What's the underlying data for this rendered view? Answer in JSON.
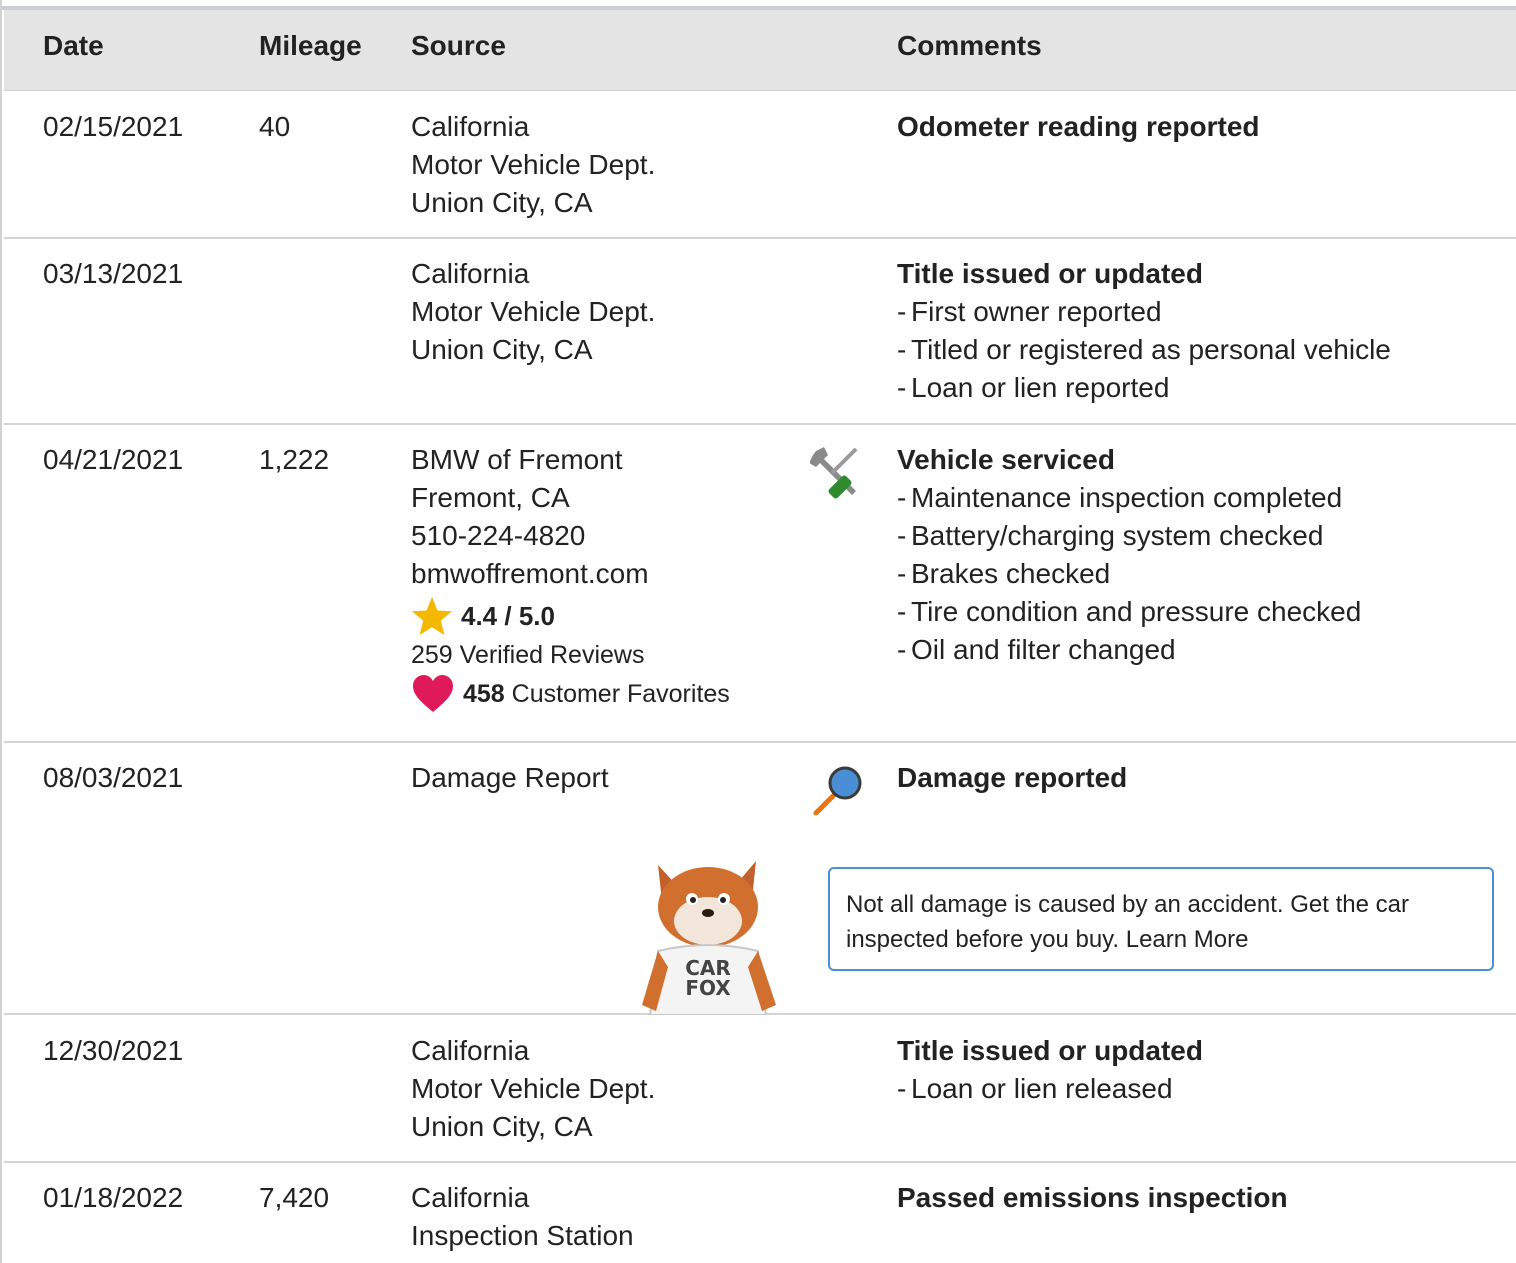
{
  "header": {
    "date": "Date",
    "mileage": "Mileage",
    "source": "Source",
    "comments": "Comments"
  },
  "rows": [
    {
      "date": "02/15/2021",
      "mileage": "40",
      "source": [
        "California",
        "Motor Vehicle Dept.",
        "Union City, CA"
      ],
      "title": "Odometer reading reported",
      "details": []
    },
    {
      "date": "03/13/2021",
      "mileage": "",
      "source": [
        "California",
        "Motor Vehicle Dept.",
        "Union City, CA"
      ],
      "title": "Title issued or updated",
      "details": [
        "First owner reported",
        "Titled or registered as personal vehicle",
        "Loan or lien reported"
      ]
    },
    {
      "date": "04/21/2021",
      "mileage": "1,222",
      "source": [
        "BMW of Fremont",
        "Fremont, CA",
        "510-224-4820",
        "bmwoffremont.com"
      ],
      "rating": "4.4 / 5.0",
      "reviews": "259 Verified Reviews",
      "favorites_count": "458",
      "favorites_label": "Customer Favorites",
      "icon": "wrench-screwdriver-icon",
      "title": "Vehicle serviced",
      "details": [
        "Maintenance inspection completed",
        "Battery/charging system checked",
        "Brakes checked",
        "Tire condition and pressure checked",
        "Oil and filter changed"
      ]
    },
    {
      "date": "08/03/2021",
      "mileage": "",
      "source": [
        "Damage Report"
      ],
      "icon": "magnifier-icon",
      "title": "Damage reported",
      "details": [],
      "notice": "Not all damage is caused by an accident. Get the car inspected before you buy. Learn More",
      "mascot_text": [
        "CAR",
        "FOX"
      ]
    },
    {
      "date": "12/30/2021",
      "mileage": "",
      "source": [
        "California",
        "Motor Vehicle Dept.",
        "Union City, CA"
      ],
      "title": "Title issued or updated",
      "details": [
        "Loan or lien released"
      ]
    },
    {
      "date": "01/18/2022",
      "mileage": "7,420",
      "source": [
        "California",
        "Inspection Station"
      ],
      "title": "Passed emissions inspection",
      "details": []
    }
  ],
  "colors": {
    "header_bg": "#e4e4e4",
    "notice_border": "#4a8fd6",
    "star": "#f5b800",
    "heart": "#e0195a",
    "magnifier_lens": "#4a8fd6",
    "magnifier_handle": "#e87511"
  }
}
